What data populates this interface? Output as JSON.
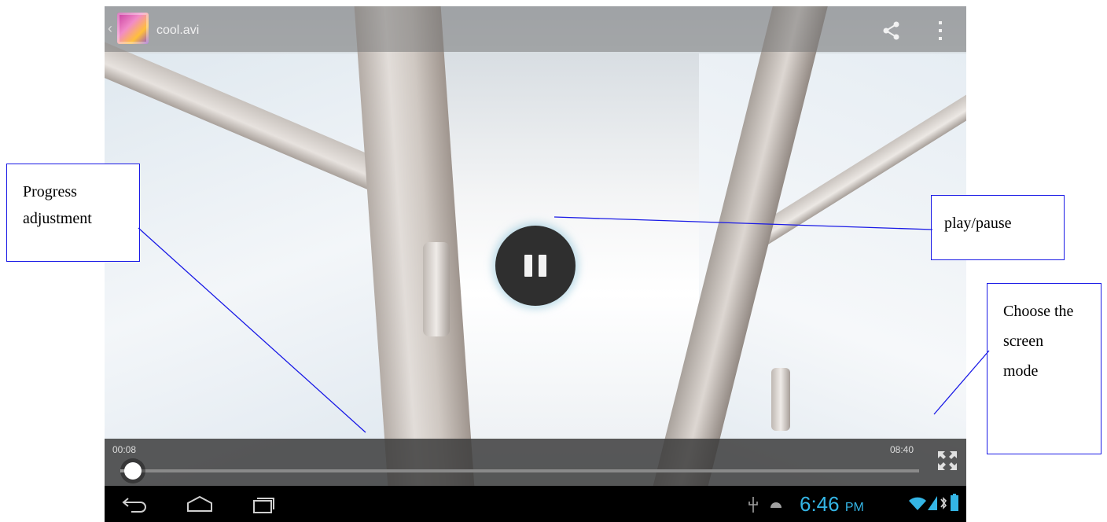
{
  "player": {
    "title": "cool.avi",
    "time_current": "00:08",
    "time_total": "08:40",
    "progress_fraction": 0.016
  },
  "status_bar": {
    "clock": "6:46",
    "ampm": "PM"
  },
  "annotations": {
    "progress": "Progress adjustment",
    "play_pause": "play/pause",
    "screen_mode": "Choose the screen mode"
  },
  "colors": {
    "clock": "#34b5e5",
    "callout_border": "#1a1ae6"
  }
}
